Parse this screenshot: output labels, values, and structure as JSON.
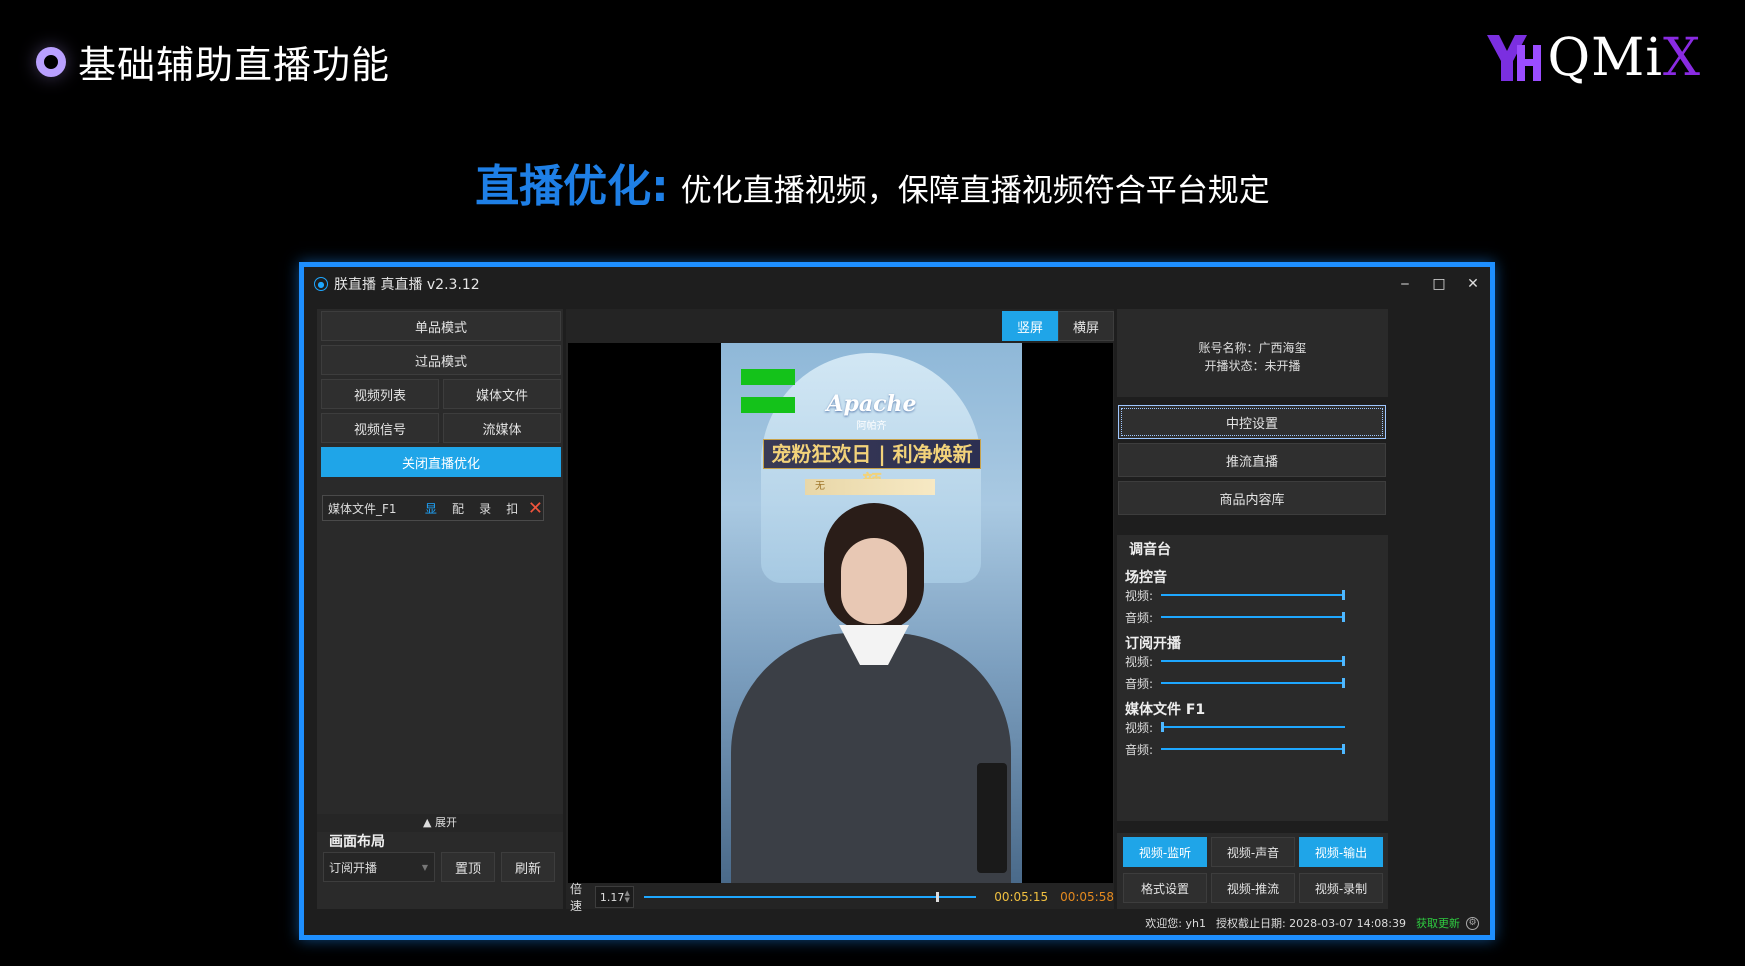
{
  "slide": {
    "title": "基础辅助直播功能",
    "headline_key": "直播优化:",
    "headline_text": "优化直播视频，保障直播视频符合平台规定",
    "logo_text_main": "QMi",
    "logo_text_accent": "X"
  },
  "app": {
    "title": "朕直播 真直播 v2.3.12",
    "window_controls": {
      "minimize": "‒",
      "maximize": "□",
      "close": "✕"
    }
  },
  "left": {
    "single_mode": "单品模式",
    "pass_mode": "过品模式",
    "video_list": "视频列表",
    "media_file": "媒体文件",
    "video_signal": "视频信号",
    "stream_media": "流媒体",
    "close_optimize": "关闭直播优化",
    "media_item": {
      "name": "媒体文件_F1",
      "action_show": "显",
      "action_match": "配",
      "action_record": "录",
      "action_cut": "扣",
      "remove": "✕"
    },
    "expand": "▲ 展开",
    "layout_title": "画面布局",
    "layout_select": "订阅开播",
    "pin_top": "置顶",
    "refresh": "刷新"
  },
  "center": {
    "portrait": "竖屏",
    "landscape": "横屏",
    "video": {
      "brand": "Apache",
      "brand_sub": "阿帕齐",
      "banner": "宠粉狂欢日 | 利净焕新颜",
      "ribbon": "无"
    },
    "speed_label": "倍速",
    "speed_value": "1.17",
    "progress": 0.88,
    "time_current": "00:05:15",
    "time_total": "00:05:58"
  },
  "right": {
    "account_name": "账号名称：广西海玺",
    "live_status": "开播状态：未开播",
    "central_control": "中控设置",
    "push_stream": "推流直播",
    "product_library": "商品内容库",
    "mixer_title": "调音台",
    "groups": [
      {
        "name": "场控音",
        "video_label": "视频:",
        "video_level": 1.0,
        "audio_label": "音频:",
        "audio_level": 1.0
      },
      {
        "name": "订阅开播",
        "video_label": "视频:",
        "video_level": 1.0,
        "audio_label": "音频:",
        "audio_level": 1.0
      },
      {
        "name": "媒体文件 F1",
        "video_label": "视频:",
        "video_level": 0.0,
        "audio_label": "音频:",
        "audio_level": 1.0
      }
    ],
    "btn_monitor": "视频-监听",
    "btn_sound": "视频-声音",
    "btn_output": "视频-输出",
    "btn_format": "格式设置",
    "btn_push": "视频-推流",
    "btn_record": "视频-录制"
  },
  "status": {
    "welcome": "欢迎您: yh1",
    "expiry": "授权截止日期: 2028-03-07 14:08:39",
    "update": "获取更新"
  },
  "colors": {
    "accent": "#1fa5e8",
    "frame_border": "#1e8fff",
    "headline_blue": "#1e7fe6",
    "time_current": "#f0c040",
    "time_total": "#e58a1f",
    "update_green": "#2ecc40",
    "remove_red": "#f0543c"
  }
}
